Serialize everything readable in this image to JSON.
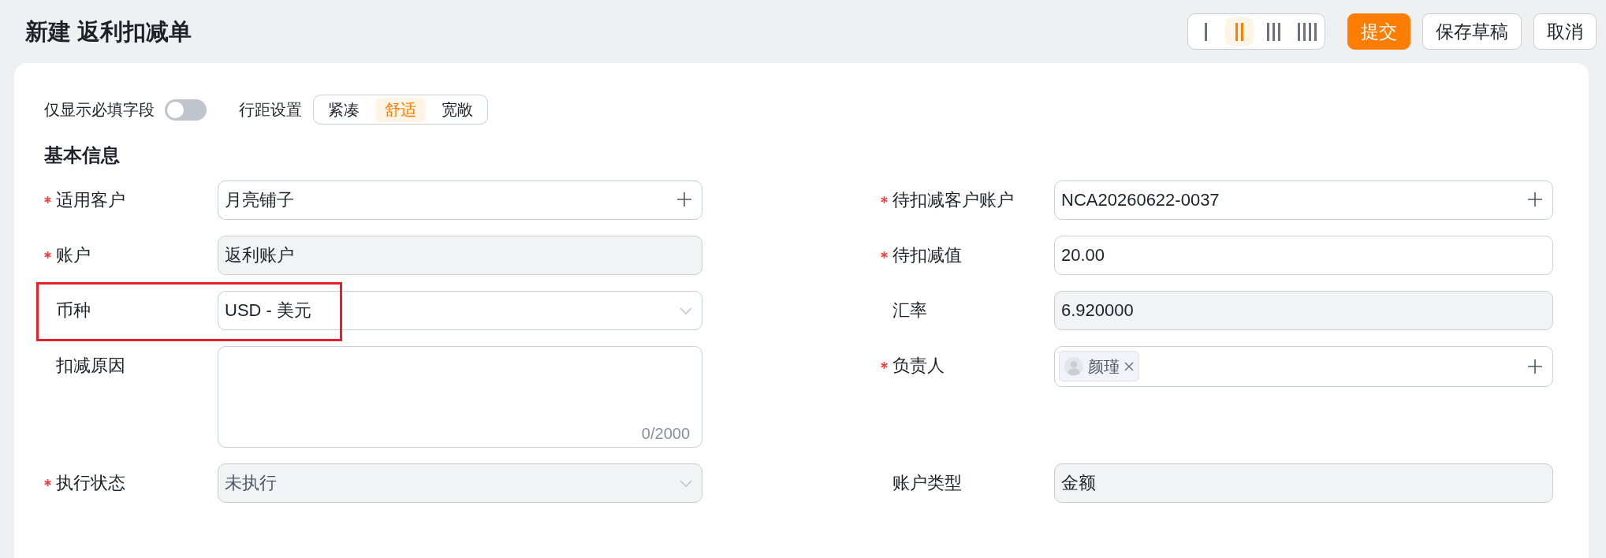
{
  "header": {
    "title": "新建 返利扣减单",
    "layout_options": [
      {
        "kind": "single",
        "selected": false
      },
      {
        "kind": "double",
        "selected": true
      },
      {
        "kind": "triple",
        "selected": false
      },
      {
        "kind": "quadruple",
        "selected": false
      }
    ],
    "buttons": [
      {
        "label": "提交",
        "kind": "primary"
      },
      {
        "label": "保存草稿",
        "kind": "default"
      },
      {
        "label": "取消",
        "kind": "default"
      }
    ]
  },
  "toolbar": {
    "required_only": {
      "label": "仅显示必填字段",
      "on": false
    },
    "row_spacing": {
      "label": "行距设置",
      "options": [
        {
          "label": "紧凑",
          "selected": false
        },
        {
          "label": "舒适",
          "selected": true
        },
        {
          "label": "宽敞",
          "selected": false
        }
      ]
    }
  },
  "section": {
    "title": "基本信息",
    "fields": [
      {
        "label": "适用客户",
        "required": true,
        "kind": "lookup",
        "value": "月亮铺子",
        "readonly": false,
        "disabled": false,
        "highlighted": false
      },
      {
        "label": "待扣减客户账户",
        "required": true,
        "kind": "lookup",
        "value": "NCA20260622-0037",
        "readonly": false,
        "disabled": false,
        "highlighted": false
      },
      {
        "label": "账户",
        "required": true,
        "kind": "text",
        "value": "返利账户",
        "readonly": true,
        "disabled": false,
        "highlighted": false
      },
      {
        "label": "待扣减值",
        "required": true,
        "kind": "text",
        "value": "20.00",
        "readonly": false,
        "disabled": false,
        "highlighted": false
      },
      {
        "label": "币种",
        "required": false,
        "kind": "select",
        "value": "USD - 美元",
        "readonly": false,
        "disabled": false,
        "highlighted": true
      },
      {
        "label": "汇率",
        "required": false,
        "kind": "text",
        "value": "6.920000",
        "readonly": true,
        "disabled": false,
        "highlighted": false
      },
      {
        "label": "扣减原因",
        "required": false,
        "kind": "textarea",
        "counter": "0/2000",
        "readonly": false,
        "disabled": false,
        "highlighted": false
      },
      {
        "label": "负责人",
        "required": true,
        "kind": "people",
        "people": [
          {
            "name": "颜瑾"
          }
        ],
        "readonly": false,
        "disabled": false,
        "highlighted": false
      },
      {
        "label": "执行状态",
        "required": true,
        "kind": "select",
        "value": "未执行",
        "readonly": true,
        "disabled": true,
        "highlighted": false
      },
      {
        "label": "账户类型",
        "required": false,
        "kind": "text",
        "value": "金额",
        "readonly": true,
        "disabled": false,
        "highlighted": false
      }
    ]
  }
}
